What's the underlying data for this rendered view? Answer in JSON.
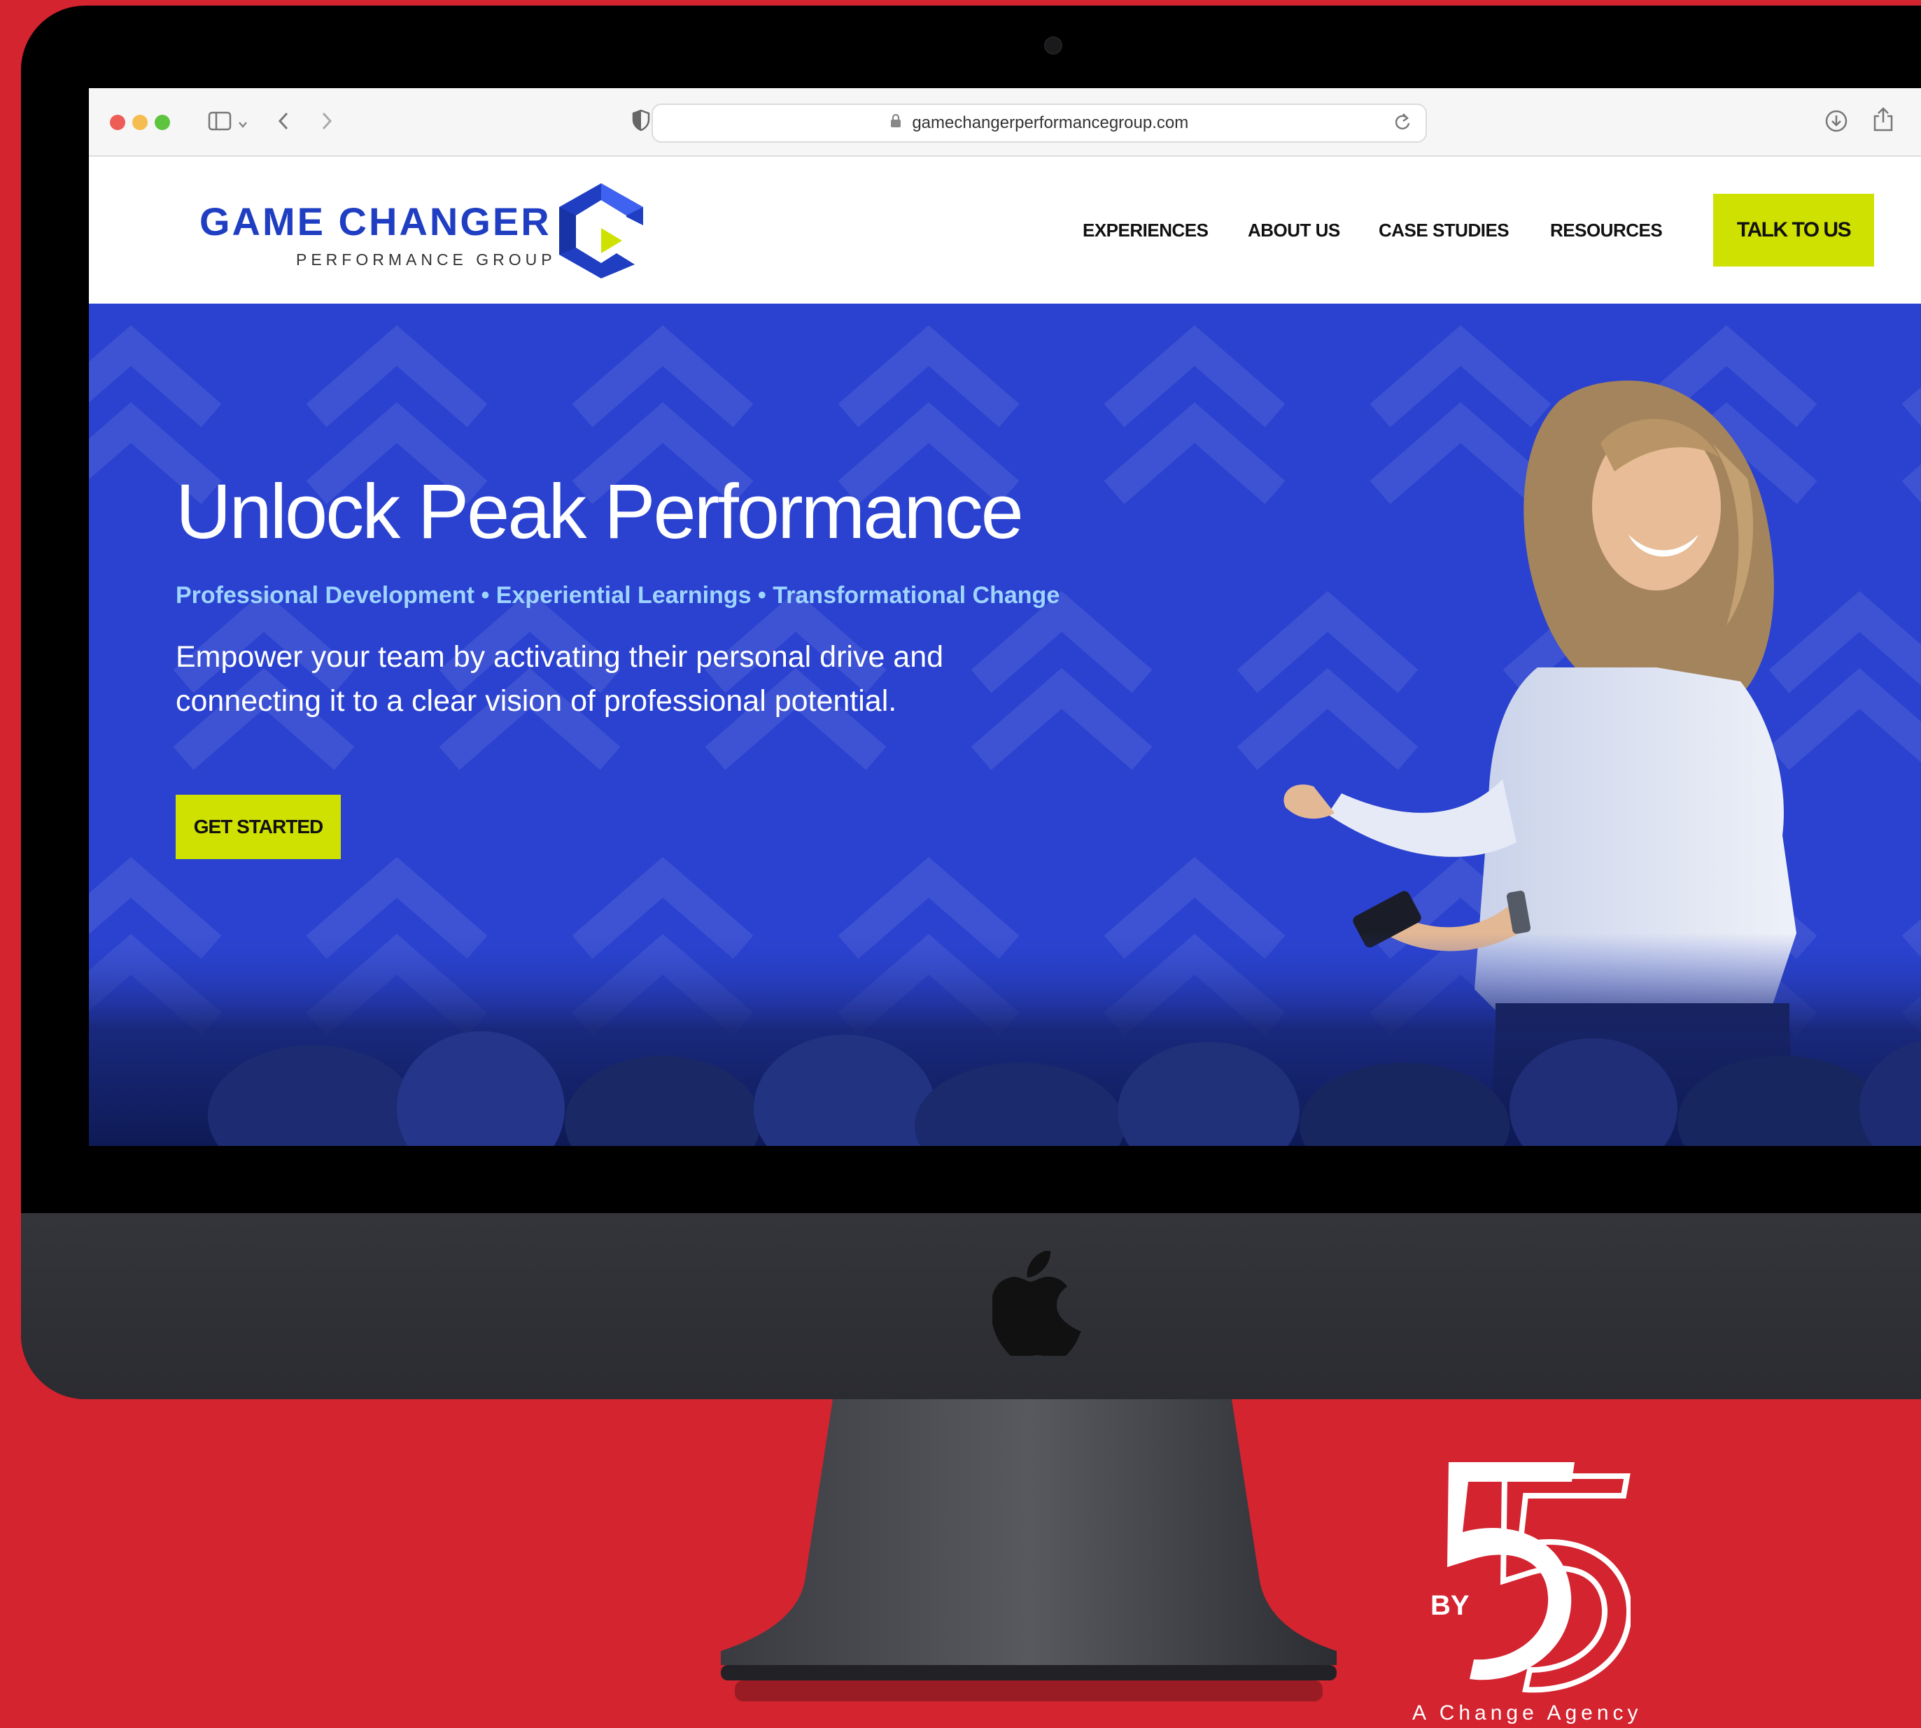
{
  "browser": {
    "url": "gamechangerperformancegroup.com"
  },
  "header": {
    "logo_title": "GAME CHANGER",
    "logo_subtitle": "PERFORMANCE GROUP",
    "nav": [
      {
        "label": "EXPERIENCES"
      },
      {
        "label": "ABOUT US"
      },
      {
        "label": "CASE STUDIES"
      },
      {
        "label": "RESOURCES"
      }
    ],
    "cta_label": "TALK TO US"
  },
  "hero": {
    "title": "Unlock Peak Performance",
    "tagline": "Professional Development • Experiential Learnings • Transformational Change",
    "body": "Empower your team by activating their personal drive and connecting it to a clear vision of professional potential.",
    "cta_label": "GET STARTED"
  },
  "agency": {
    "by_text": "BY",
    "number": "55",
    "tagline": "A Change Agency"
  },
  "colors": {
    "background_red": "#d32430",
    "hero_blue": "#2a42cf",
    "brand_blue": "#1f3ec2",
    "accent_lime": "#cfe100"
  },
  "icons": {
    "sidebar": "sidebar-icon",
    "back": "chevron-left-icon",
    "forward": "chevron-right-icon",
    "privacy": "shield-icon",
    "lock": "lock-icon",
    "reload": "reload-icon",
    "download": "download-icon",
    "share": "share-icon",
    "new_tab": "plus-icon"
  }
}
